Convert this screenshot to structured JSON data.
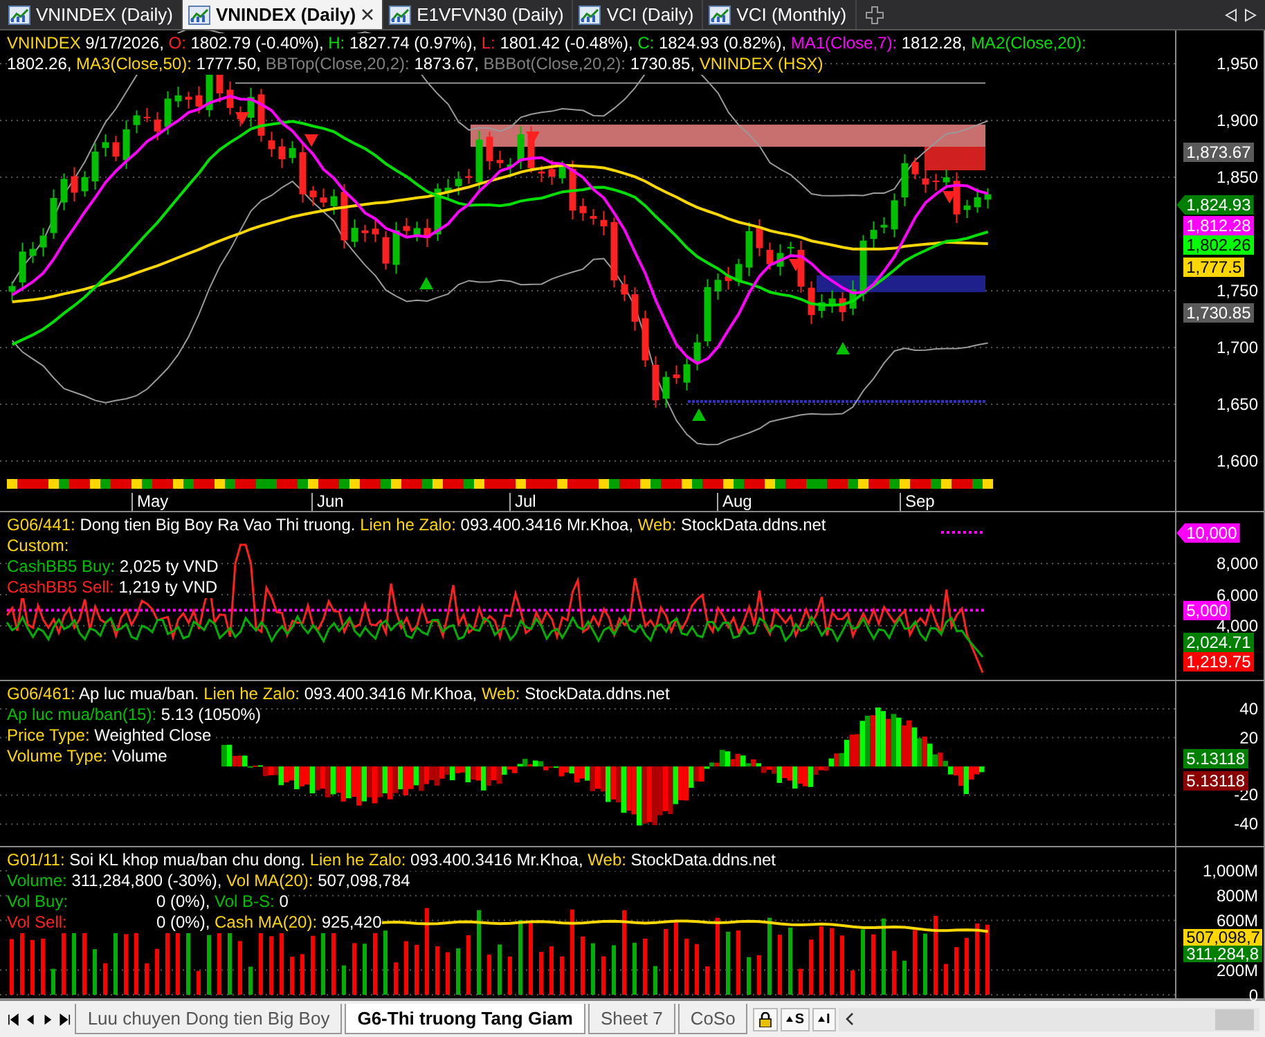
{
  "tabs": [
    {
      "label": "VNINDEX (Daily)",
      "selected": false
    },
    {
      "label": "VNINDEX (Daily)",
      "selected": true
    },
    {
      "label": "E1VFVN30 (Daily)",
      "selected": false
    },
    {
      "label": "VCI (Daily)",
      "selected": false
    },
    {
      "label": "VCI (Monthly)",
      "selected": false
    }
  ],
  "panes": [
    {
      "kind": "price",
      "legend": [
        [
          {
            "text": "VNINDEX",
            "color": "#ffd700"
          },
          {
            "text": " 9/17/2026, ",
            "color": "#ffffff"
          },
          {
            "text": "O:",
            "color": "#ff2020"
          },
          {
            "text": " 1802.79 (-0.40%), ",
            "color": "#ffffff"
          },
          {
            "text": "H:",
            "color": "#00e000"
          },
          {
            "text": " 1827.74 (0.97%), ",
            "color": "#ffffff"
          },
          {
            "text": "L:",
            "color": "#ff2020"
          },
          {
            "text": " 1801.42 (-0.48%), ",
            "color": "#ffffff"
          },
          {
            "text": "C:",
            "color": "#00e000"
          },
          {
            "text": " 1824.93 (0.82%), ",
            "color": "#ffffff"
          },
          {
            "text": "MA1(Close,7):",
            "color": "#ff00ff"
          },
          {
            "text": " 1812.28, ",
            "color": "#ffffff"
          },
          {
            "text": "MA2(Close,20):",
            "color": "#00e000"
          }
        ],
        [
          {
            "text": "1802.26, ",
            "color": "#ffffff"
          },
          {
            "text": "MA3(Close,50):",
            "color": "#ffd700"
          },
          {
            "text": " 1777.50, ",
            "color": "#ffffff"
          },
          {
            "text": "BBTop(Close,20,2):",
            "color": "#808080"
          },
          {
            "text": " 1873.67, ",
            "color": "#ffffff"
          },
          {
            "text": "BBBot(Close,20,2):",
            "color": "#808080"
          },
          {
            "text": " 1730.85, ",
            "color": "#ffffff"
          },
          {
            "text": "VNINDEX (HSX)",
            "color": "#ffd700"
          }
        ]
      ],
      "ticks": [
        "1,950",
        "1,900",
        "1,850",
        "1,750",
        "1,700",
        "1,650",
        "1,600"
      ],
      "tags": [
        {
          "text": "1,873.67",
          "color": "#5a5a5a",
          "kind": "box"
        },
        {
          "text": "1,824.93",
          "color": "#008000",
          "kind": "arrow"
        },
        {
          "text": "1,812.28",
          "color": "#ff00ff",
          "kind": "box"
        },
        {
          "text": "1,802.26",
          "color": "#00ff00",
          "kind": "box"
        },
        {
          "text": "1,777.5",
          "color": "#ffd700",
          "kind": "box"
        },
        {
          "text": "1,730.85",
          "color": "#5a5a5a",
          "kind": "box"
        }
      ],
      "x_axis_labels": [
        "May",
        "Jun",
        "Jul",
        "Aug",
        "Sep"
      ]
    },
    {
      "kind": "cashflow",
      "legend": [
        [
          {
            "text": "G06/441:",
            "color": "#ffd700"
          },
          {
            "text": " Dong tien Big Boy Ra Vao Thi truong. ",
            "color": "#ffffff"
          },
          {
            "text": "Lien he Zalo:",
            "color": "#ffd700"
          },
          {
            "text": " 093.400.3416 Mr.Khoa, ",
            "color": "#ffffff"
          },
          {
            "text": "Web:",
            "color": "#ffd700"
          },
          {
            "text": " StockData.ddns.net",
            "color": "#ffffff"
          }
        ],
        [
          {
            "text": "Custom:",
            "color": "#ffd700"
          }
        ],
        [
          {
            "text": "CashBB5 Buy:",
            "color": "#00c000"
          },
          {
            "text": " 2,025 ty VND",
            "color": "#ffffff"
          }
        ],
        [
          {
            "text": "CashBB5 Sell:",
            "color": "#ff2020"
          },
          {
            "text": " 1,219 ty VND",
            "color": "#ffffff"
          }
        ]
      ],
      "ticks": [
        "8,000",
        "6,000",
        "4,000"
      ],
      "tags": [
        {
          "text": "10,000",
          "color": "#ff00ff",
          "kind": "arrow"
        },
        {
          "text": "5,000",
          "color": "#ff00ff",
          "kind": "box"
        },
        {
          "text": "2,024.71",
          "color": "#008000",
          "kind": "box"
        },
        {
          "text": "1,219.75",
          "color": "#ff0000",
          "kind": "box"
        }
      ]
    },
    {
      "kind": "oscillator",
      "legend": [
        [
          {
            "text": "G06/461:",
            "color": "#ffd700"
          },
          {
            "text": " Ap luc mua/ban. ",
            "color": "#ffffff"
          },
          {
            "text": "Lien he Zalo:",
            "color": "#ffd700"
          },
          {
            "text": " 093.400.3416 Mr.Khoa, ",
            "color": "#ffffff"
          },
          {
            "text": "Web:",
            "color": "#ffd700"
          },
          {
            "text": " StockData.ddns.net",
            "color": "#ffffff"
          }
        ],
        [
          {
            "text": "Ap luc mua/ban(15):",
            "color": "#00c000"
          },
          {
            "text": " 5.13 (1050%)",
            "color": "#ffffff"
          }
        ],
        [
          {
            "text": "Price Type:",
            "color": "#ffd700"
          },
          {
            "text": " Weighted Close",
            "color": "#ffffff"
          }
        ],
        [
          {
            "text": "Volume Type:",
            "color": "#ffd700"
          },
          {
            "text": " Volume",
            "color": "#ffffff"
          }
        ]
      ],
      "ticks": [
        "40",
        "20",
        "-20",
        "-40"
      ],
      "tags": [
        {
          "text": "5.13118",
          "color": "#008000",
          "kind": "box"
        },
        {
          "text": "5.13118",
          "color": "#8b0000",
          "kind": "box"
        }
      ]
    },
    {
      "kind": "volume",
      "legend": [
        [
          {
            "text": "G01/11:",
            "color": "#ffd700"
          },
          {
            "text": " Soi KL khop mua/ban chu dong. ",
            "color": "#ffffff"
          },
          {
            "text": "Lien he Zalo:",
            "color": "#ffd700"
          },
          {
            "text": " 093.400.3416 Mr.Khoa, ",
            "color": "#ffffff"
          },
          {
            "text": "Web:",
            "color": "#ffd700"
          },
          {
            "text": " StockData.ddns.net",
            "color": "#ffffff"
          }
        ],
        [
          {
            "text": "Volume:",
            "color": "#00c000"
          },
          {
            "text": " 311,284,800 (-30%), ",
            "color": "#ffffff"
          },
          {
            "text": "Vol MA(20):",
            "color": "#ffd700"
          },
          {
            "text": " 507,098,784",
            "color": "#ffffff"
          }
        ],
        [
          {
            "text": "Vol Buy:",
            "color": "#00c000",
            "tab": true
          },
          {
            "text": "0 (0%), ",
            "color": "#ffffff"
          },
          {
            "text": "Vol B-S:",
            "color": "#00c000"
          },
          {
            "text": " 0",
            "color": "#ffffff"
          }
        ],
        [
          {
            "text": "Vol Sell:",
            "color": "#ff2020",
            "tab": true
          },
          {
            "text": "0 (0%), ",
            "color": "#ffffff"
          },
          {
            "text": "Cash MA(20):",
            "color": "#ffd700"
          },
          {
            "text": " 925,420",
            "color": "#ffffff"
          }
        ]
      ],
      "ticks": [
        "1,000M",
        "800M",
        "600M",
        "200M",
        "0"
      ],
      "tags": [
        {
          "text": "507,098,7",
          "color": "#ffd700",
          "kind": "box"
        },
        {
          "text": "311,284,8",
          "color": "#008000",
          "kind": "box"
        }
      ]
    }
  ],
  "sheet_tabs": [
    {
      "label": "Luu chuyen Dong tien Big Boy",
      "selected": false
    },
    {
      "label": "G6-Thi truong Tang Giam",
      "selected": true
    },
    {
      "label": "Sheet 7",
      "selected": false
    },
    {
      "label": "CoSo",
      "selected": false
    }
  ],
  "sheet_buttons": [
    "S",
    "I"
  ]
}
